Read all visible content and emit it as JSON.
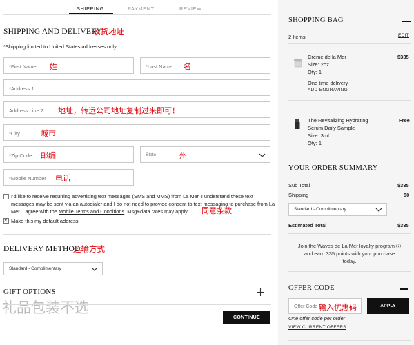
{
  "checkout": {
    "tabs": [
      "SHIPPING",
      "PAYMENT",
      "REVIEW"
    ],
    "shipping": {
      "title": "SHIPPING AND DELIVERY",
      "title_note": "收货地址",
      "limited_note": "*Shipping limited to United States addresses only",
      "fields": {
        "first_name": {
          "placeholder": "*First Name",
          "note": "姓"
        },
        "last_name": {
          "placeholder": "*Last Name",
          "note": "名"
        },
        "address1": {
          "placeholder": "*Address 1"
        },
        "address2": {
          "placeholder": "Address Line 2",
          "note": "地址，转运公司地址复制过来即可！"
        },
        "city": {
          "placeholder": "*City",
          "note": "城市"
        },
        "zip": {
          "placeholder": "*Zip Code",
          "note": "邮编"
        },
        "state": {
          "placeholder": "State",
          "note": "州"
        },
        "mobile": {
          "placeholder": "*Mobile Number",
          "note": "电话"
        }
      },
      "sms_consent": {
        "checked": false,
        "text_1": "I'd like to receive recurring advertising text messages (SMS and MMS) from La Mer. I understand these text",
        "text_2": "messages may be sent via an autodialer and I do not need to provide consent to text messaging to purchase from La",
        "text_3_prefix": "Mer. I agree with the ",
        "terms_link": "Mobile Terms and Conditions",
        "text_3_suffix": ". Msg&data rates may apply.",
        "note": "同意条款"
      },
      "default_address": {
        "checked": true,
        "label": "Make this my default address"
      }
    },
    "delivery": {
      "title": "DELIVERY METHOD",
      "title_note": "运输方式",
      "selected": "Standard - Complimentary"
    },
    "gift": {
      "title": "GIFT OPTIONS",
      "note": "礼品包装不选"
    },
    "continue_label": "CONTINUE"
  },
  "bag": {
    "title": "SHOPPING BAG",
    "count": "2 Items",
    "edit": "EDIT",
    "items": [
      {
        "name": "Crème de la Mer",
        "price": "$335",
        "size": "Size: 2oz",
        "qty": "Qty: 1",
        "delivery": "One time delivery",
        "engraving": "ADD ENGRAVING"
      },
      {
        "name_1": "The Revitalizing Hydrating",
        "name_2": "Serum Daily Sample",
        "price": "Free",
        "size": "Size: 3ml",
        "qty": "Qty: 1"
      }
    ]
  },
  "summary": {
    "title": "YOUR ORDER SUMMARY",
    "subtotal_label": "Sub Total",
    "subtotal": "$335",
    "shipping_label": "Shipping",
    "shipping": "$0",
    "shipping_select": "Standard - Complimentary",
    "total_label": "Estimated Total",
    "total": "$335",
    "loyalty_1": "Join the Waves de La Mer loyalty program",
    "loyalty_2": "and earn 335 points with your purchase",
    "loyalty_3": "today."
  },
  "offer": {
    "title": "OFFER CODE",
    "placeholder": "Offer Code",
    "note": "输入优惠码",
    "apply": "APPLY",
    "one_per_order": "One offer code per order",
    "view_offers": "VIEW CURRENT OFFERS"
  },
  "colors": {
    "accent": "#111111",
    "annotation": "#e0000a",
    "panel": "#f5f5f5"
  }
}
